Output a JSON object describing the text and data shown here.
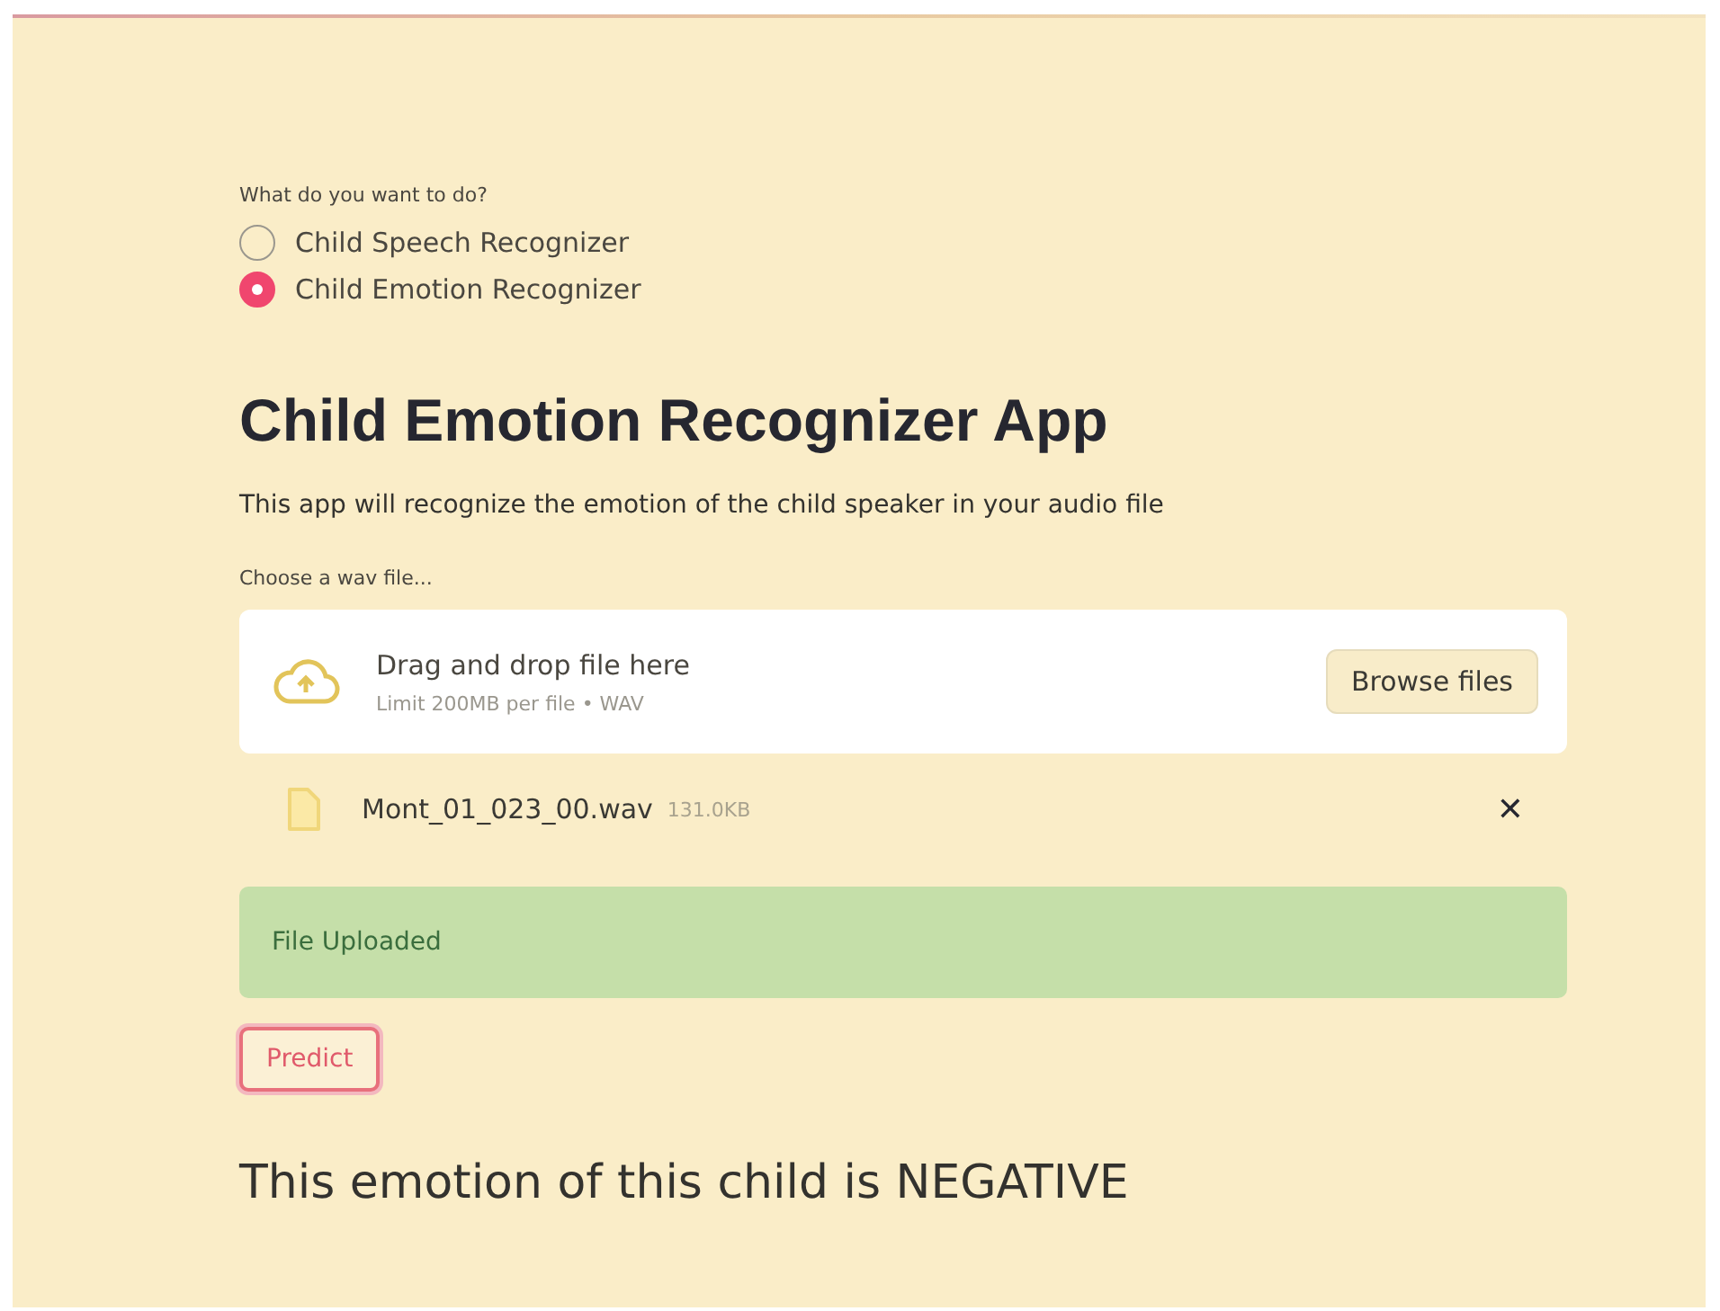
{
  "radio_group": {
    "label": "What do you want to do?",
    "options": [
      {
        "label": "Child Speech Recognizer",
        "selected": false
      },
      {
        "label": "Child Emotion Recognizer",
        "selected": true
      }
    ]
  },
  "title": "Child Emotion Recognizer App",
  "description": "This app will recognize the emotion of the child speaker in your audio file",
  "uploader": {
    "label": "Choose a wav file...",
    "drop_text": "Drag and drop file here",
    "limit_text": "Limit 200MB per file • WAV",
    "button": "Browse files"
  },
  "file": {
    "name": "Mont_01_023_00.wav",
    "size": "131.0KB",
    "remove": "✕"
  },
  "alert": "File Uploaded",
  "predict_button": "Predict",
  "result": "This emotion of this child is NEGATIVE"
}
